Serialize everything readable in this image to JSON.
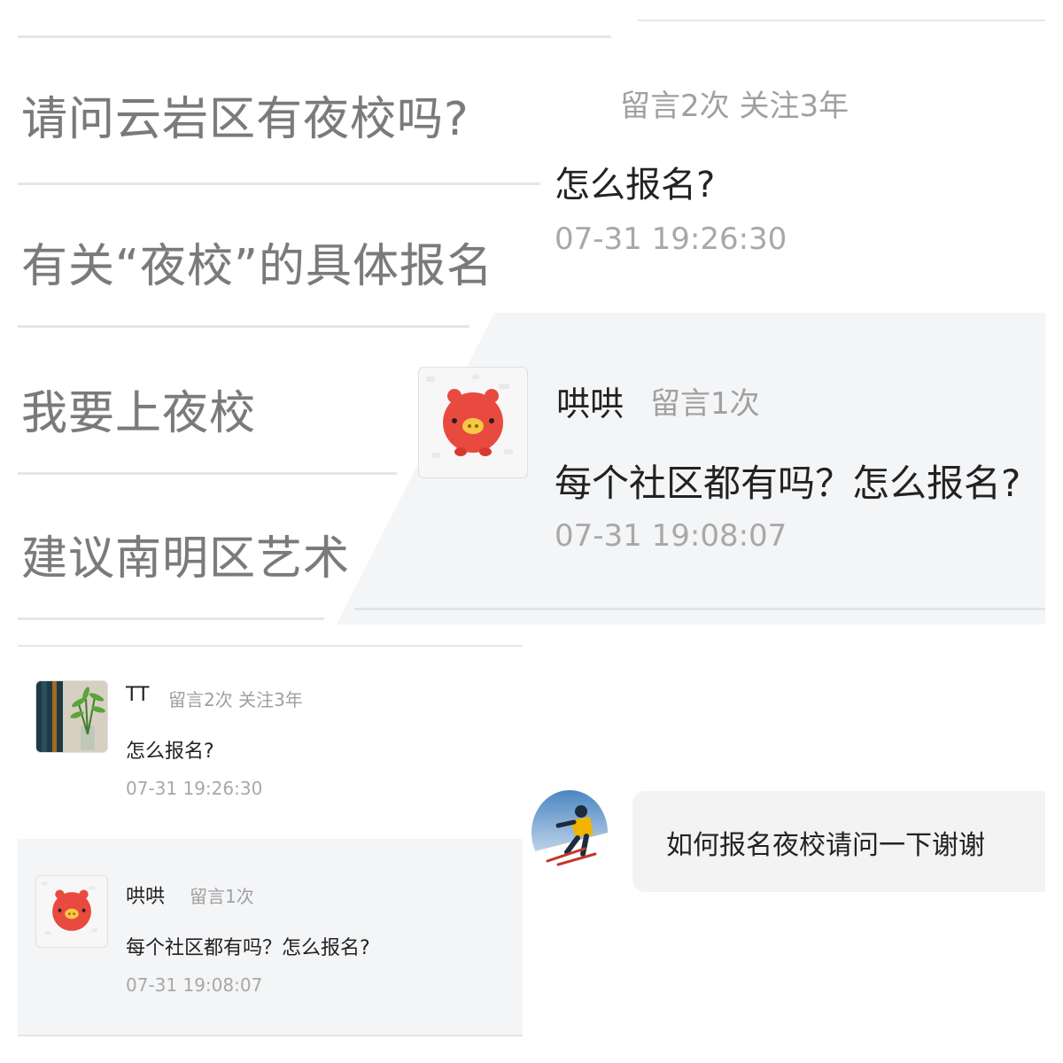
{
  "questions": [
    {
      "title": "请问云岩区有夜校吗?"
    },
    {
      "title": "有关“夜校”的具体报名"
    },
    {
      "title": "我要上夜校"
    },
    {
      "title": "建议南明区艺术"
    }
  ],
  "zoomed": {
    "comment1": {
      "meta": "留言2次 关注3年",
      "content": "怎么报名?",
      "time": "07-31 19:26:30"
    },
    "comment2": {
      "name": "哄哄",
      "count": "留言1次",
      "content": "每个社区都有吗？怎么报名?",
      "time": "07-31 19:08:07",
      "avatar_icon": "pig-icon"
    }
  },
  "comments": [
    {
      "name": "TT",
      "meta": "留言2次 关注3年",
      "content": "怎么报名?",
      "time": "07-31 19:26:30",
      "avatar_icon": "plant-avatar"
    },
    {
      "name": "哄哄",
      "meta": "留言1次",
      "content": "每个社区都有吗？怎么报名?",
      "time": "07-31 19:08:07",
      "avatar_icon": "pig-icon"
    }
  ],
  "chat": {
    "message": "如何报名夜校请问一下谢谢",
    "avatar_icon": "skier-avatar"
  },
  "colors": {
    "panel_gray": "#f4f5f7",
    "divider": "#e6e6e6",
    "muted_text": "#a0a0a0",
    "pig_red": "#e94a3f"
  }
}
